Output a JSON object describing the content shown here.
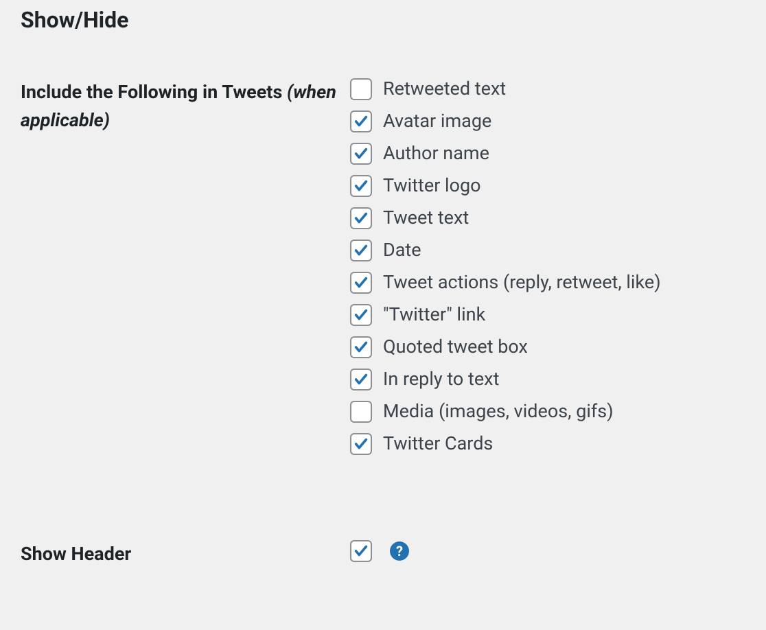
{
  "section_title": "Show/Hide",
  "include_row": {
    "label_main": "Include the Following in Tweets ",
    "label_sub": "(when applicable)",
    "options": [
      {
        "label": "Retweeted text",
        "checked": false
      },
      {
        "label": "Avatar image",
        "checked": true
      },
      {
        "label": "Author name",
        "checked": true
      },
      {
        "label": "Twitter logo",
        "checked": true
      },
      {
        "label": "Tweet text",
        "checked": true
      },
      {
        "label": "Date",
        "checked": true
      },
      {
        "label": "Tweet actions (reply, retweet, like)",
        "checked": true
      },
      {
        "label": "\"Twitter\" link",
        "checked": true
      },
      {
        "label": "Quoted tweet box",
        "checked": true
      },
      {
        "label": "In reply to text",
        "checked": true
      },
      {
        "label": "Media (images, videos, gifs)",
        "checked": false
      },
      {
        "label": "Twitter Cards",
        "checked": true
      }
    ]
  },
  "show_header": {
    "label": "Show Header",
    "checked": true,
    "help_char": "?"
  }
}
